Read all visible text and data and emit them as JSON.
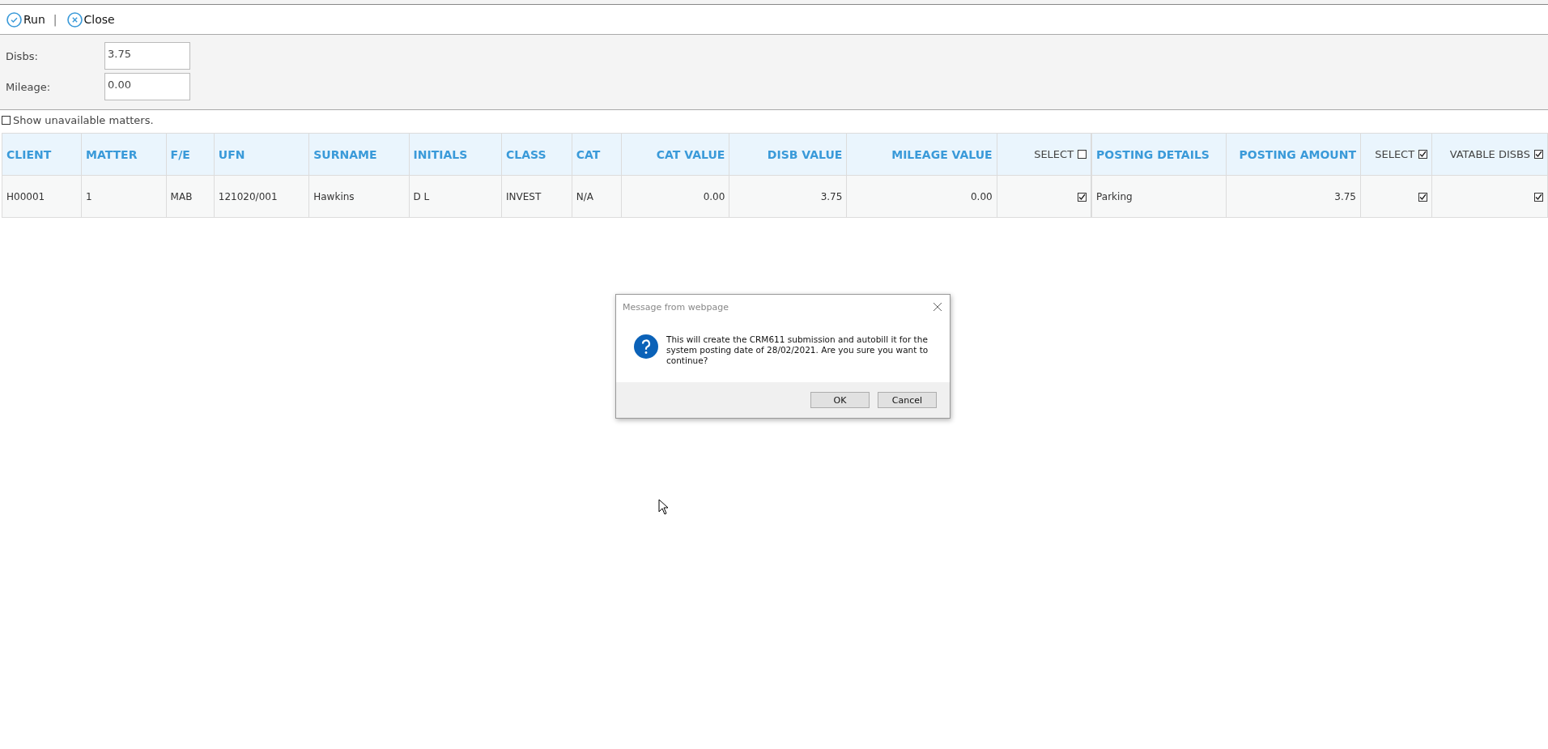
{
  "toolbar": {
    "buttons": [
      {
        "kind": "run",
        "label": "Run"
      },
      {
        "kind": "close",
        "label": "Close"
      }
    ],
    "separator": "|"
  },
  "fields": [
    {
      "label": "Disbs:",
      "value": "3.75"
    },
    {
      "label": "Mileage:",
      "value": "0.00"
    }
  ],
  "show_unavailable": {
    "label": "Show unavailable matters.",
    "checked": false
  },
  "tables": [
    {
      "columns": [
        {
          "label": "CLIENT",
          "kind": "text"
        },
        {
          "label": "MATTER",
          "kind": "text"
        },
        {
          "label": "F/E",
          "kind": "text"
        },
        {
          "label": "UFN",
          "kind": "text"
        },
        {
          "label": "SURNAME",
          "kind": "text"
        },
        {
          "label": "INITIALS",
          "kind": "text"
        },
        {
          "label": "CLASS",
          "kind": "text"
        },
        {
          "label": "CAT",
          "kind": "text"
        },
        {
          "label": "CAT VALUE",
          "kind": "number"
        },
        {
          "label": "DISB VALUE",
          "kind": "number"
        },
        {
          "label": "MILEAGE VALUE",
          "kind": "number"
        },
        {
          "label": "SELECT",
          "kind": "checkbox",
          "checked": false
        }
      ],
      "rows": [
        {
          "cells": [
            {
              "text": "H00001"
            },
            {
              "text": "1"
            },
            {
              "text": "MAB"
            },
            {
              "text": "121020/001"
            },
            {
              "text": "Hawkins"
            },
            {
              "text": "D L"
            },
            {
              "text": "INVEST"
            },
            {
              "text": "N/A"
            },
            {
              "text": "0.00"
            },
            {
              "text": "3.75"
            },
            {
              "text": "0.00"
            },
            {
              "checked": true
            }
          ]
        }
      ]
    },
    {
      "columns": [
        {
          "label": "POSTING DETAILS",
          "kind": "text"
        },
        {
          "label": "POSTING AMOUNT",
          "kind": "number"
        },
        {
          "label": "SELECT",
          "kind": "checkbox",
          "checked": true
        },
        {
          "label": "VATABLE DISBS",
          "kind": "checkbox",
          "checked": true
        }
      ],
      "rows": [
        {
          "cells": [
            {
              "text": "Parking"
            },
            {
              "text": "3.75"
            },
            {
              "checked": true
            },
            {
              "checked": true
            }
          ]
        }
      ]
    }
  ],
  "dialog": {
    "title": "Message from webpage",
    "message": "This will create the CRM611 submission and autobill it for the system posting date of 28/02/2021. Are you sure you want to continue?",
    "buttons": [
      "OK",
      "Cancel"
    ]
  }
}
